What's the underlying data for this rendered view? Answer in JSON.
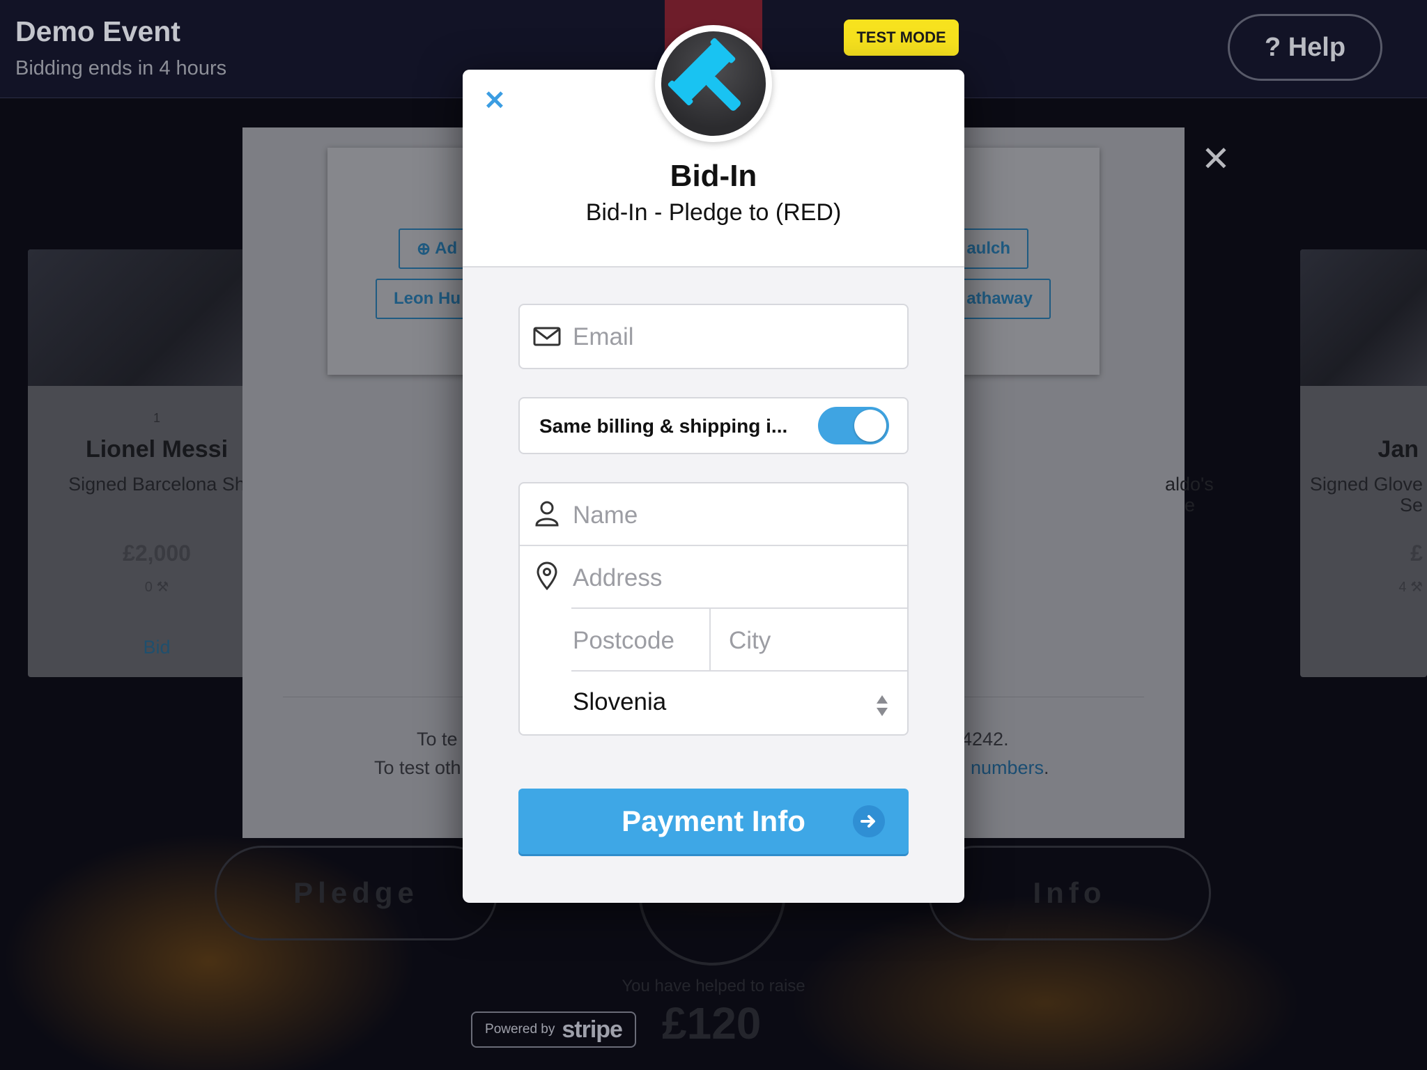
{
  "topbar": {
    "event_title": "Demo Event",
    "event_subtitle": "Bidding ends in 4 hours",
    "help_label": "? Help",
    "test_mode_label": "TEST MODE"
  },
  "cards": [
    {
      "num": "1",
      "name": "Lionel Messi",
      "desc": "Signed Barcelona Sh",
      "price": "£2,000",
      "bids": "0",
      "bid_label": "Bid"
    },
    {
      "name": "Jan",
      "desc": "Signed Glove",
      "desc2": "Se",
      "price": "£",
      "bids": "4"
    }
  ],
  "panel": {
    "add_label": "Ad",
    "leon_label": "Leon Hu",
    "aulch_label": "aulch",
    "athaway_label": "athaway",
    "aldo_label": "aldo's",
    "aldo_label2": "e",
    "test_line1_left": "To te",
    "test_line1_right": "4242.",
    "test_line2_left": "To test oth",
    "test_line2_link": "numbers",
    "test_line2_end": "."
  },
  "bottom": {
    "pledge_label": "Pledge",
    "info_label": "Info",
    "raise_text": "You have helped to raise",
    "raise_amount": "£120",
    "powered_by": "Powered by",
    "stripe": "stripe"
  },
  "modal": {
    "title": "Bid-In",
    "subtitle": "Bid-In - Pledge to (RED)",
    "email_placeholder": "Email",
    "toggle_label": "Same billing & shipping i...",
    "toggle_on": true,
    "name_placeholder": "Name",
    "address_placeholder": "Address",
    "postcode_placeholder": "Postcode",
    "city_placeholder": "City",
    "country_value": "Slovenia",
    "pay_button_label": "Payment Info"
  },
  "colors": {
    "accent": "#3ea7e6",
    "test_mode": "#f7e21e",
    "logo_gavel": "#19c3f2"
  }
}
